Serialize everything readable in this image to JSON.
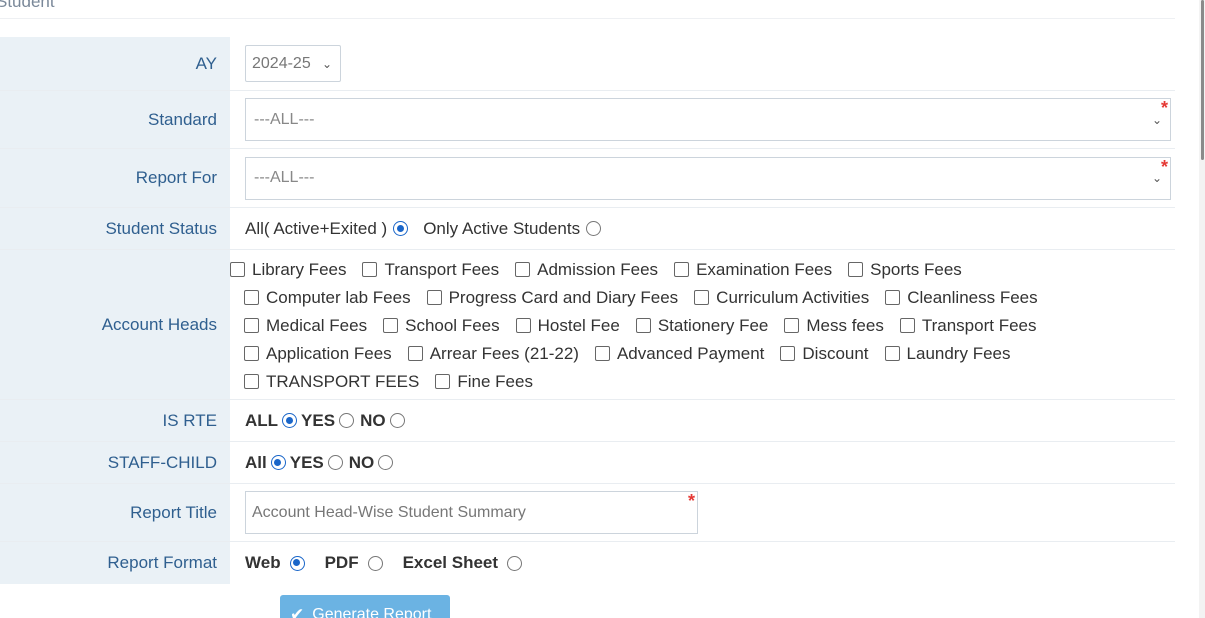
{
  "page": {
    "heading": "Student"
  },
  "form": {
    "ay": {
      "label": "AY",
      "value": "2024-25"
    },
    "standard": {
      "label": "Standard",
      "value": "---ALL---"
    },
    "report_for": {
      "label": "Report For",
      "value": "---ALL---"
    },
    "student_status": {
      "label": "Student Status",
      "options": [
        {
          "label": "All( Active+Exited )",
          "selected": true
        },
        {
          "label": "Only Active Students",
          "selected": false
        }
      ]
    },
    "account_heads": {
      "label": "Account Heads",
      "lines": [
        [
          "Library Fees",
          "Transport Fees",
          "Admission Fees",
          "Examination Fees",
          "Sports Fees"
        ],
        [
          "Computer lab Fees",
          "Progress Card and Diary Fees",
          "Curriculum Activities",
          "Cleanliness Fees"
        ],
        [
          "Medical Fees",
          "School Fees",
          "Hostel Fee",
          "Stationery Fee",
          "Mess fees",
          "Transport Fees"
        ],
        [
          "Application Fees",
          "Arrear Fees (21-22)",
          "Advanced Payment",
          "Discount",
          "Laundry Fees"
        ],
        [
          "TRANSPORT FEES",
          "Fine Fees"
        ]
      ]
    },
    "is_rte": {
      "label": "IS RTE",
      "options": [
        {
          "label": "ALL",
          "selected": true
        },
        {
          "label": "YES",
          "selected": false
        },
        {
          "label": "NO",
          "selected": false
        }
      ]
    },
    "staff_child": {
      "label": "STAFF-CHILD",
      "options": [
        {
          "label": "All",
          "selected": true
        },
        {
          "label": "YES",
          "selected": false
        },
        {
          "label": "NO",
          "selected": false
        }
      ]
    },
    "report_title": {
      "label": "Report Title",
      "value": "Account Head-Wise Student Summary"
    },
    "report_format": {
      "label": "Report Format",
      "options": [
        {
          "label": "Web",
          "selected": true
        },
        {
          "label": "PDF",
          "selected": false
        },
        {
          "label": "Excel Sheet",
          "selected": false
        }
      ]
    }
  },
  "actions": {
    "generate_label": "Generate Report"
  },
  "colors": {
    "label_bg": "#eaf1f6",
    "label_text": "#2f5f8f",
    "accent": "#1a66c9",
    "button": "#6bb3e3",
    "required": "#e53935"
  }
}
